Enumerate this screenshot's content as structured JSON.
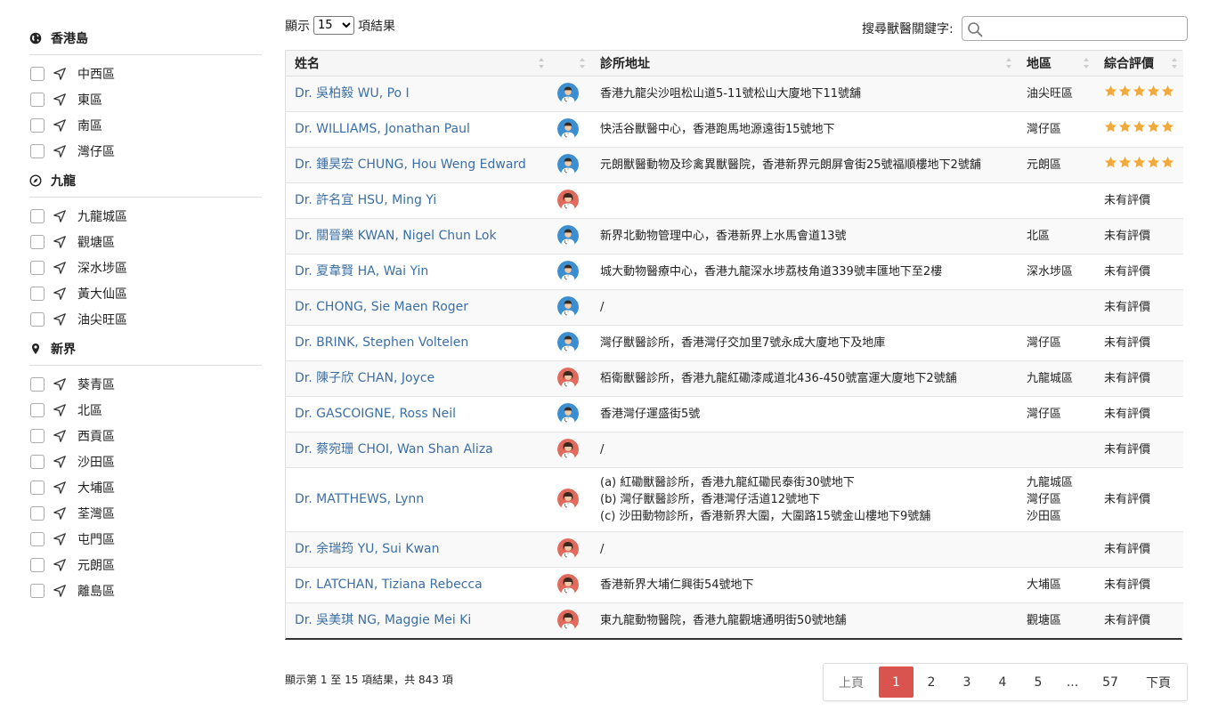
{
  "sidebar": {
    "regions": [
      {
        "name": "香港島",
        "icon": "globe-icon",
        "districts": [
          "中西區",
          "東區",
          "南區",
          "灣仔區"
        ]
      },
      {
        "name": "九龍",
        "icon": "compass-icon",
        "districts": [
          "九龍城區",
          "觀塘區",
          "深水埗區",
          "黃大仙區",
          "油尖旺區"
        ]
      },
      {
        "name": "新界",
        "icon": "map-pin-icon",
        "districts": [
          "葵青區",
          "北區",
          "西貢區",
          "沙田區",
          "大埔區",
          "荃灣區",
          "屯門區",
          "元朗區",
          "離島區"
        ]
      }
    ]
  },
  "controls": {
    "show_prefix": "顯示",
    "page_size": "15",
    "page_size_options": [
      "15"
    ],
    "show_suffix": "項結果",
    "search_label": "搜尋獸醫關鍵字:",
    "search_value": ""
  },
  "table": {
    "headers": {
      "name": "姓名",
      "address": "診所地址",
      "district": "地區",
      "rating": "綜合評價"
    },
    "rows": [
      {
        "name": "Dr. 吳柏毅 WU, Po I",
        "gender": "male",
        "address": [
          "香港九龍尖沙咀松山道5-11號松山大廈地下11號舖"
        ],
        "district": [
          "油尖旺區"
        ],
        "stars": 5,
        "rating_text": ""
      },
      {
        "name": "Dr. WILLIAMS, Jonathan Paul",
        "gender": "male",
        "address": [
          "快活谷獸醫中心，香港跑馬地源遠街15號地下"
        ],
        "district": [
          "灣仔區"
        ],
        "stars": 5,
        "rating_text": ""
      },
      {
        "name": "Dr. 鍾昊宏 CHUNG, Hou Weng Edward",
        "gender": "male",
        "address": [
          "元朗獸醫動物及珍禽異獸醫院，香港新界元朗屏會街25號福順樓地下2號舖"
        ],
        "district": [
          "元朗區"
        ],
        "stars": 5,
        "rating_text": ""
      },
      {
        "name": "Dr. 許名宜 HSU, Ming Yi",
        "gender": "female",
        "address": [
          ""
        ],
        "district": [
          ""
        ],
        "stars": 0,
        "rating_text": "未有評價"
      },
      {
        "name": "Dr. 關晉樂 KWAN, Nigel Chun Lok",
        "gender": "male",
        "address": [
          "新界北動物管理中心，香港新界上水馬會道13號"
        ],
        "district": [
          "北區"
        ],
        "stars": 0,
        "rating_text": "未有評價"
      },
      {
        "name": "Dr. 夏韋賢 HA, Wai Yin",
        "gender": "male",
        "address": [
          "城大動物醫療中心，香港九龍深水埗荔枝角道339號丰匯地下至2樓"
        ],
        "district": [
          "深水埗區"
        ],
        "stars": 0,
        "rating_text": "未有評價"
      },
      {
        "name": "Dr. CHONG, Sie Maen Roger",
        "gender": "male",
        "address": [
          "/"
        ],
        "district": [
          ""
        ],
        "stars": 0,
        "rating_text": "未有評價"
      },
      {
        "name": "Dr. BRINK, Stephen Voltelen",
        "gender": "male",
        "address": [
          "灣仔獸醫診所，香港灣仔交加里7號永成大廈地下及地庫"
        ],
        "district": [
          "灣仔區"
        ],
        "stars": 0,
        "rating_text": "未有評價"
      },
      {
        "name": "Dr. 陳子欣 CHAN, Joyce",
        "gender": "female",
        "address": [
          "栢衛獸醫診所，香港九龍紅磡漆咸道北436-450號富運大廈地下2號舖"
        ],
        "district": [
          "九龍城區"
        ],
        "stars": 0,
        "rating_text": "未有評價"
      },
      {
        "name": "Dr. GASCOIGNE, Ross Neil",
        "gender": "male",
        "address": [
          "香港灣仔運盛街5號"
        ],
        "district": [
          "灣仔區"
        ],
        "stars": 0,
        "rating_text": "未有評價"
      },
      {
        "name": "Dr. 蔡宛珊 CHOI, Wan Shan Aliza",
        "gender": "female",
        "address": [
          "/"
        ],
        "district": [
          ""
        ],
        "stars": 0,
        "rating_text": "未有評價"
      },
      {
        "name": "Dr. MATTHEWS, Lynn",
        "gender": "female",
        "address": [
          "(a) 紅磡獸醫診所，香港九龍紅磡民泰街30號地下",
          "(b) 灣仔獸醫診所，香港灣仔活道12號地下",
          "(c) 沙田動物診所，香港新界大圍，大圍路15號金山樓地下9號舖"
        ],
        "district": [
          "九龍城區",
          "灣仔區",
          "沙田區"
        ],
        "stars": 0,
        "rating_text": "未有評價"
      },
      {
        "name": "Dr. 余瑞筠 YU, Sui Kwan",
        "gender": "female",
        "address": [
          "/"
        ],
        "district": [
          ""
        ],
        "stars": 0,
        "rating_text": "未有評價"
      },
      {
        "name": "Dr. LATCHAN, Tiziana Rebecca",
        "gender": "female",
        "address": [
          "香港新界大埔仁興街54號地下"
        ],
        "district": [
          "大埔區"
        ],
        "stars": 0,
        "rating_text": "未有評價"
      },
      {
        "name": "Dr. 吳美琪 NG, Maggie Mei Ki",
        "gender": "female",
        "address": [
          "東九龍動物醫院，香港九龍觀塘通明街50號地舖"
        ],
        "district": [
          "觀塘區"
        ],
        "stars": 0,
        "rating_text": "未有評價"
      }
    ]
  },
  "footer": {
    "info": "顯示第 1 至 15 項結果，共 843 項",
    "prev": "上頁",
    "pages": [
      "1",
      "2",
      "3",
      "4",
      "5"
    ],
    "ellipsis": "...",
    "last": "57",
    "next": "下頁",
    "current": "1"
  },
  "colors": {
    "link": "#3a6ea5",
    "star": "#f0a93b",
    "active_page": "#d9534f",
    "male_avatar": "#3b8fd0",
    "female_avatar": "#e06a5c"
  }
}
